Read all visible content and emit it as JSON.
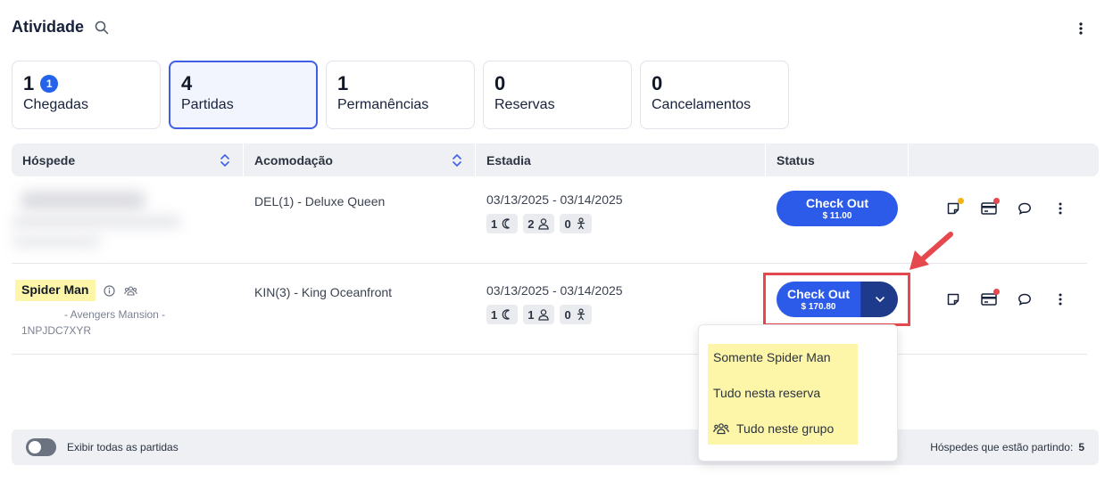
{
  "header": {
    "title": "Atividade"
  },
  "cards": [
    {
      "count": "1",
      "label": "Chegadas",
      "badge": "1"
    },
    {
      "count": "4",
      "label": "Partidas"
    },
    {
      "count": "1",
      "label": "Permanências"
    },
    {
      "count": "0",
      "label": "Reservas"
    },
    {
      "count": "0",
      "label": "Cancelamentos"
    }
  ],
  "table": {
    "columns": [
      "Hóspede",
      "Acomodação",
      "Estadia",
      "Status"
    ],
    "rows": [
      {
        "accommodation": "DEL(1) - Deluxe Queen",
        "dates": "03/13/2025 - 03/14/2025",
        "nights": "1",
        "adults": "2",
        "children": "0",
        "status_label": "Check Out",
        "amount": "$ 11.00"
      },
      {
        "guest_name": "Spider Man",
        "guest_sub": "- Avengers Mansion -",
        "guest_code": "1NPJDC7XYR",
        "accommodation": "KIN(3) - King Oceanfront",
        "dates": "03/13/2025 - 03/14/2025",
        "nights": "1",
        "adults": "1",
        "children": "0",
        "status_label": "Check Out",
        "amount": "$ 170.80"
      }
    ]
  },
  "dropdown_menu": {
    "items": [
      "Somente Spider Man",
      "Tudo nesta reserva",
      "Tudo neste grupo"
    ]
  },
  "footer": {
    "toggle_label": "Exibir todas as partidas",
    "summary_label": "Hóspedes que estão partindo:",
    "summary_value": "5"
  },
  "colors": {
    "primary": "#2b5be8",
    "primary_dark": "#1e3a8a",
    "highlight": "#fdf6a8",
    "annotation": "#e5484d"
  }
}
